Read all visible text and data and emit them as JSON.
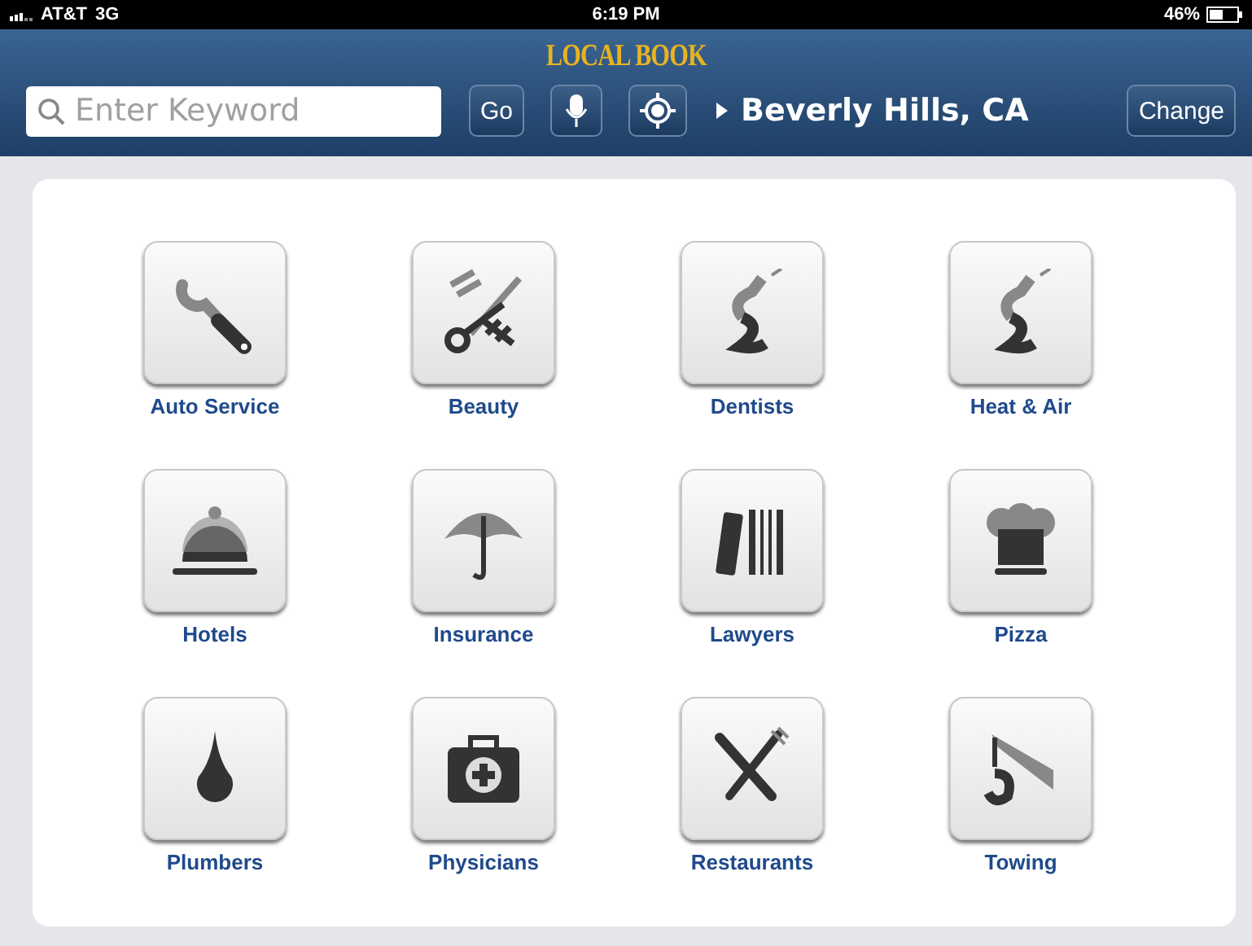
{
  "status_bar": {
    "carrier": "AT&T",
    "network": "3G",
    "time": "6:19 PM",
    "battery": "46%"
  },
  "header": {
    "logo": "LOCAL BOOK",
    "search": {
      "placeholder": "Enter Keyword"
    },
    "go_button": "Go",
    "location": "Beverly Hills, CA",
    "change_button": "Change"
  },
  "categories": [
    {
      "label": "Auto Service"
    },
    {
      "label": "Beauty"
    },
    {
      "label": "Dentists"
    },
    {
      "label": "Heat & Air"
    },
    {
      "label": "Hotels"
    },
    {
      "label": "Insurance"
    },
    {
      "label": "Lawyers"
    },
    {
      "label": "Pizza"
    },
    {
      "label": "Plumbers"
    },
    {
      "label": "Physicians"
    },
    {
      "label": "Restaurants"
    },
    {
      "label": "Towing"
    }
  ]
}
